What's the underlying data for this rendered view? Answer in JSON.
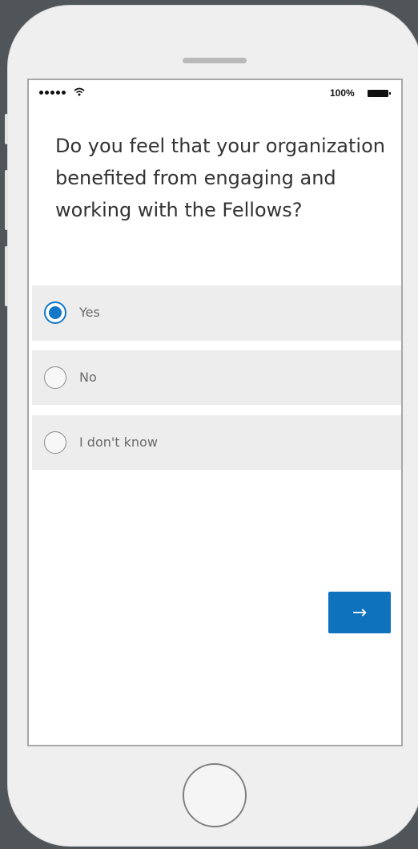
{
  "status_bar": {
    "signal_icon": "signal-dots-icon",
    "wifi_icon": "wifi-icon",
    "battery_text": "100%",
    "battery_icon": "battery-full-icon"
  },
  "survey": {
    "question": "Do you feel that your organization benefited from engaging and working with the Fellows?",
    "options": [
      {
        "label": "Yes",
        "selected": true
      },
      {
        "label": "No",
        "selected": false
      },
      {
        "label": "I don't know",
        "selected": false
      }
    ],
    "next_button": {
      "label": "→",
      "icon": "arrow-right-icon"
    }
  },
  "device": {
    "home_button_icon": "home-button-icon",
    "speaker_icon": "speaker-grille-icon"
  },
  "colors": {
    "accent": "#1478c8",
    "button": "#0f72bd",
    "option_background": "#ededed",
    "phone_body": "#efefef",
    "outer_background": "#4f5559"
  }
}
